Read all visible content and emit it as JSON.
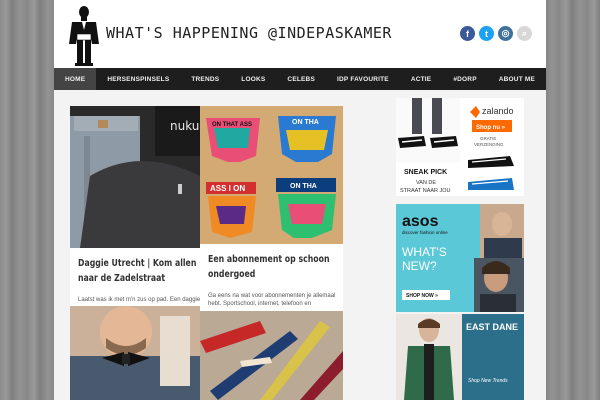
{
  "site": {
    "title": "WHAT'S HAPPENING @INDEPASKAMER"
  },
  "social": [
    {
      "name": "facebook-icon",
      "glyph": "f",
      "color": "#3b5998"
    },
    {
      "name": "twitter-icon",
      "glyph": "t",
      "color": "#1da1f2"
    },
    {
      "name": "instagram-icon",
      "glyph": "◎",
      "color": "#3f729b"
    },
    {
      "name": "search-icon",
      "glyph": "⌕",
      "color": "#d8d8d8"
    }
  ],
  "nav": [
    "HOME",
    "HERSENSPINSELS",
    "TRENDS",
    "LOOKS",
    "CELEBS",
    "IDP FAVOURITE",
    "ACTIE",
    "#DORP",
    "ABOUT ME"
  ],
  "posts": [
    {
      "image_text": "nukuhiv",
      "title": "Daggie Utrecht | Kom allen naar de Zadelstraat",
      "excerpt": "Laatst was ik met m'n zus op pad. Een daggie"
    },
    {
      "image_texts": [
        "ON THAT ASS",
        "ON THA",
        "ASS I ON",
        "ON THA"
      ],
      "title": "Een abonnement op schoon ondergoed",
      "excerpt": "Ga eens na wat voor abonnementen je allemaal hebt. Sportschool, internet, telefoon en"
    }
  ],
  "ads": {
    "zalando": {
      "brand": "zalando",
      "button": "Shop nu »",
      "note1": "GRATIE",
      "note2": "VERZENDING",
      "heading": "SNEAK PICK",
      "sub1": "VAN DE",
      "sub2": "STRAAT NAAR JOU"
    },
    "asos": {
      "brand": "asos",
      "tagline": "discover fashion online",
      "line1": "WHAT'S",
      "line2": "NEW?",
      "button": "SHOP NOW »"
    },
    "eastdane": {
      "brand": "EAST DANE",
      "link": "Shop New Trends"
    }
  }
}
